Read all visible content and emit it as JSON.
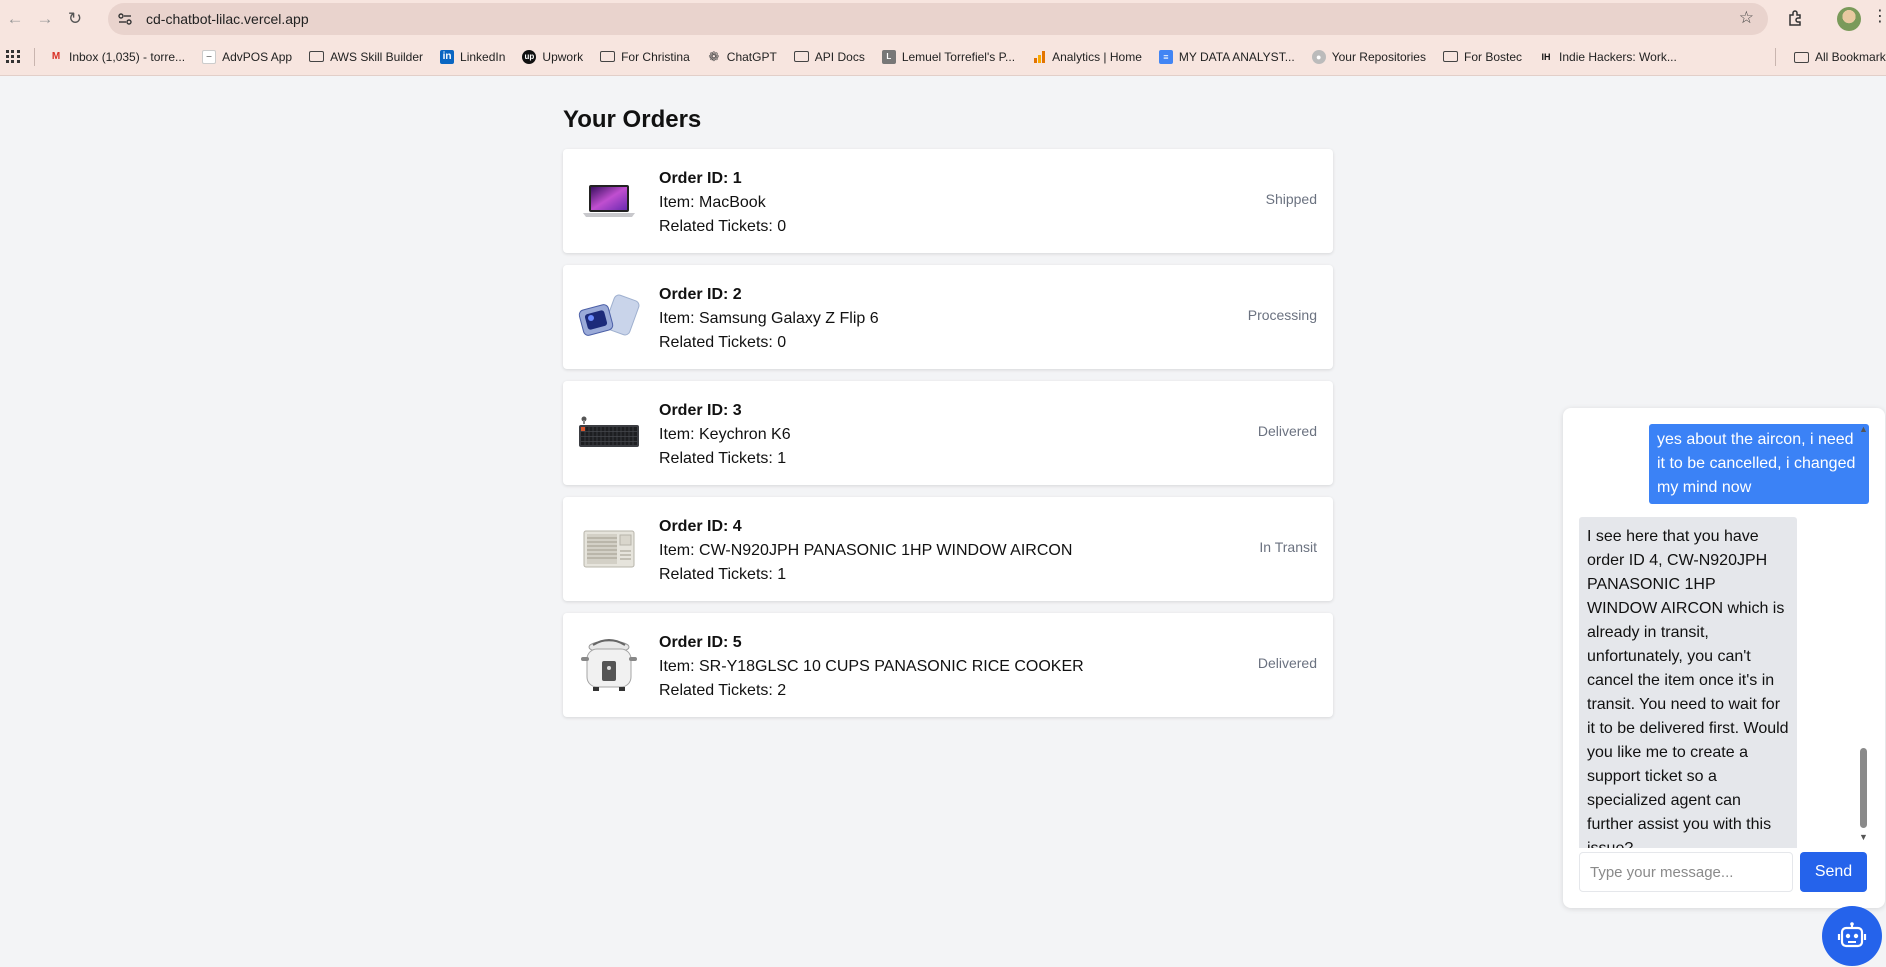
{
  "browser": {
    "url": "cd-chatbot-lilac.vercel.app",
    "bookmarks": [
      {
        "label": "Inbox (1,035) - torre...",
        "icon": "gmail-icon"
      },
      {
        "label": "AdvPOS App",
        "icon": "page-icon"
      },
      {
        "label": "AWS Skill Builder",
        "icon": "folder-icon"
      },
      {
        "label": "LinkedIn",
        "icon": "linkedin-icon"
      },
      {
        "label": "Upwork",
        "icon": "upwork-icon"
      },
      {
        "label": "For Christina",
        "icon": "folder-icon"
      },
      {
        "label": "ChatGPT",
        "icon": "chatgpt-icon"
      },
      {
        "label": "API Docs",
        "icon": "folder-icon"
      },
      {
        "label": "Lemuel Torrefiel's P...",
        "icon": "page-icon"
      },
      {
        "label": "Analytics | Home",
        "icon": "analytics-icon"
      },
      {
        "label": "MY DATA ANALYST...",
        "icon": "docs-icon"
      },
      {
        "label": "Your Repositories",
        "icon": "github-icon"
      },
      {
        "label": "For Bostec",
        "icon": "folder-icon"
      },
      {
        "label": "Indie Hackers: Work...",
        "icon": "indiehackers-icon"
      }
    ],
    "all_bookmarks": "All Bookmarks"
  },
  "page": {
    "title": "Your Orders"
  },
  "orders": [
    {
      "id_label": "Order ID: 1",
      "item_label": "Item: MacBook",
      "tickets_label": "Related Tickets: 0",
      "status": "Shipped",
      "image": "macbook-image"
    },
    {
      "id_label": "Order ID: 2",
      "item_label": "Item: Samsung Galaxy Z Flip 6",
      "tickets_label": "Related Tickets: 0",
      "status": "Processing",
      "image": "phone-image"
    },
    {
      "id_label": "Order ID: 3",
      "item_label": "Item: Keychron K6",
      "tickets_label": "Related Tickets: 1",
      "status": "Delivered",
      "image": "keyboard-image"
    },
    {
      "id_label": "Order ID: 4",
      "item_label": "Item: CW-N920JPH PANASONIC 1HP WINDOW AIRCON",
      "tickets_label": "Related Tickets: 1",
      "status": "In Transit",
      "image": "aircon-image"
    },
    {
      "id_label": "Order ID: 5",
      "item_label": "Item: SR-Y18GLSC 10 CUPS PANASONIC RICE COOKER",
      "tickets_label": "Related Tickets: 2",
      "status": "Delivered",
      "image": "rice-cooker-image"
    }
  ],
  "chat": {
    "user_message": "yes about the aircon, i need it to be cancelled, i changed my mind now",
    "bot_message": "I see here that you have order ID 4, CW-N920JPH PANASONIC 1HP WINDOW AIRCON which is already in transit, unfortunately, you can't cancel the item once it's in transit. You need to wait for it to be delivered first. Would you like me to create a support ticket so a specialized agent can further assist you with this issue?",
    "input_placeholder": "Type your message...",
    "input_value": "",
    "send_label": "Send"
  },
  "colors": {
    "accent": "#2563eb",
    "user_bubble": "#3b82f6",
    "bot_bubble": "#e5e7eb",
    "status_text": "#6b7280",
    "browser_chrome": "#f7e5df"
  }
}
